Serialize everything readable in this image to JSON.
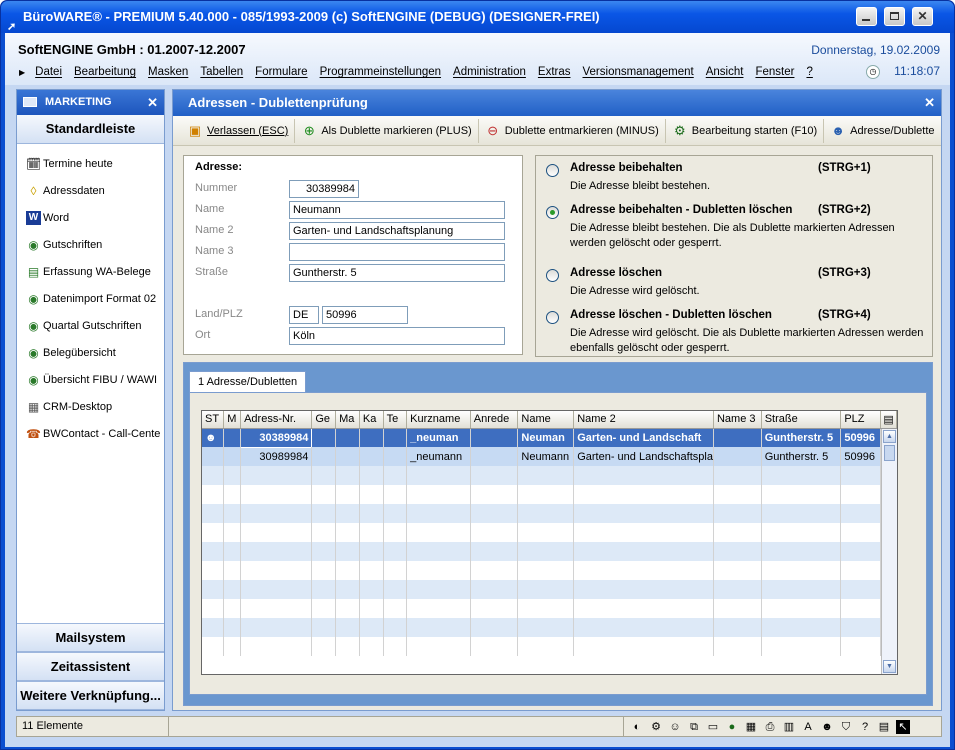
{
  "window": {
    "title": "BüroWARE® - PREMIUM  5.40.000 - 085/1993-2009 (c) SoftENGINE (DEBUG) (DESIGNER-FREI)"
  },
  "header": {
    "company": "SoftENGINE GmbH : 01.2007-12.2007",
    "date": "Donnerstag, 19.02.2009",
    "time": "11:18:07"
  },
  "menu": [
    "Datei",
    "Bearbeitung",
    "Masken",
    "Tabellen",
    "Formulare",
    "Programmeinstellungen",
    "Administration",
    "Extras",
    "Versionsmanagement",
    "Ansicht",
    "Fenster",
    "?"
  ],
  "sidebar": {
    "title": "MARKETING",
    "section": "Standardleiste",
    "items": [
      {
        "label": "Termine heute",
        "icon": "calendar-icon"
      },
      {
        "label": "Adressdaten",
        "icon": "address-icon"
      },
      {
        "label": "Word",
        "icon": "word-icon"
      },
      {
        "label": "Gutschriften",
        "icon": "eye-icon"
      },
      {
        "label": "Erfassung WA-Belege",
        "icon": "document-icon"
      },
      {
        "label": "Datenimport Format 02",
        "icon": "eye-icon"
      },
      {
        "label": "Quartal Gutschriften",
        "icon": "eye-icon"
      },
      {
        "label": "Belegübersicht",
        "icon": "eye-icon"
      },
      {
        "label": "Übersicht FIBU / WAWI",
        "icon": "eye-icon"
      },
      {
        "label": "CRM-Desktop",
        "icon": "crm-icon"
      },
      {
        "label": "BWContact - Call-Cente",
        "icon": "contact-icon"
      }
    ],
    "bottom_sections": [
      "Mailsystem",
      "Zeitassistent",
      "Weitere Verknüpfung..."
    ]
  },
  "main": {
    "title": "Adressen - Dublettenprüfung",
    "toolbar": [
      "Verlassen (ESC)",
      "Als Dublette markieren (PLUS)",
      "Dublette entmarkieren (MINUS)",
      "Bearbeitung starten (F10)",
      "Adresse/Dublette"
    ],
    "address": {
      "heading": "Adresse:",
      "labels": {
        "nummer": "Nummer",
        "name": "Name",
        "name2": "Name 2",
        "name3": "Name 3",
        "strasse": "Straße",
        "landplz": "Land/PLZ",
        "ort": "Ort"
      },
      "values": {
        "nummer": "30389984",
        "name": "Neumann",
        "name2": "Garten- und Landschaftsplanung",
        "name3": "",
        "strasse": "Guntherstr. 5",
        "land": "DE",
        "plz": "50996",
        "ort": "Köln"
      }
    },
    "options": [
      {
        "title": "Adresse beibehalten",
        "key": "(STRG+1)",
        "desc": "Die Adresse bleibt bestehen.",
        "selected": false
      },
      {
        "title": "Adresse beibehalten - Dubletten löschen",
        "key": "(STRG+2)",
        "desc": "Die Adresse bleibt bestehen. Die als Dublette markierten Adressen werden gelöscht oder gesperrt.",
        "selected": true
      },
      {
        "title": "Adresse löschen",
        "key": "(STRG+3)",
        "desc": "Die Adresse wird gelöscht.",
        "selected": false
      },
      {
        "title": "Adresse löschen - Dubletten löschen",
        "key": "(STRG+4)",
        "desc": "Die Adresse wird gelöscht. Die als Dublette markierten Adressen werden ebenfalls gelöscht oder gesperrt.",
        "selected": false
      }
    ],
    "tab": "1 Adresse/Dubletten",
    "grid": {
      "columns": [
        "ST",
        "M",
        "Adress-Nr.",
        "Ge",
        "Ma",
        "Ka",
        "Te",
        "Kurzname",
        "Anrede",
        "Name",
        "Name 2",
        "Name 3",
        "Straße",
        "PLZ"
      ],
      "rows": [
        [
          "",
          "",
          "30389984",
          "",
          "",
          "",
          "",
          "_neuman",
          "",
          "Neuman",
          "Garten- und Landschaft",
          "",
          "Guntherstr. 5",
          "50996"
        ],
        [
          "",
          "",
          "30989984",
          "",
          "",
          "",
          "",
          "_neumann",
          "",
          "Neumann",
          "Garten- und Landschaftspla",
          "",
          "Guntherstr. 5",
          "50996"
        ]
      ]
    }
  },
  "status": {
    "count": "11 Elemente"
  }
}
